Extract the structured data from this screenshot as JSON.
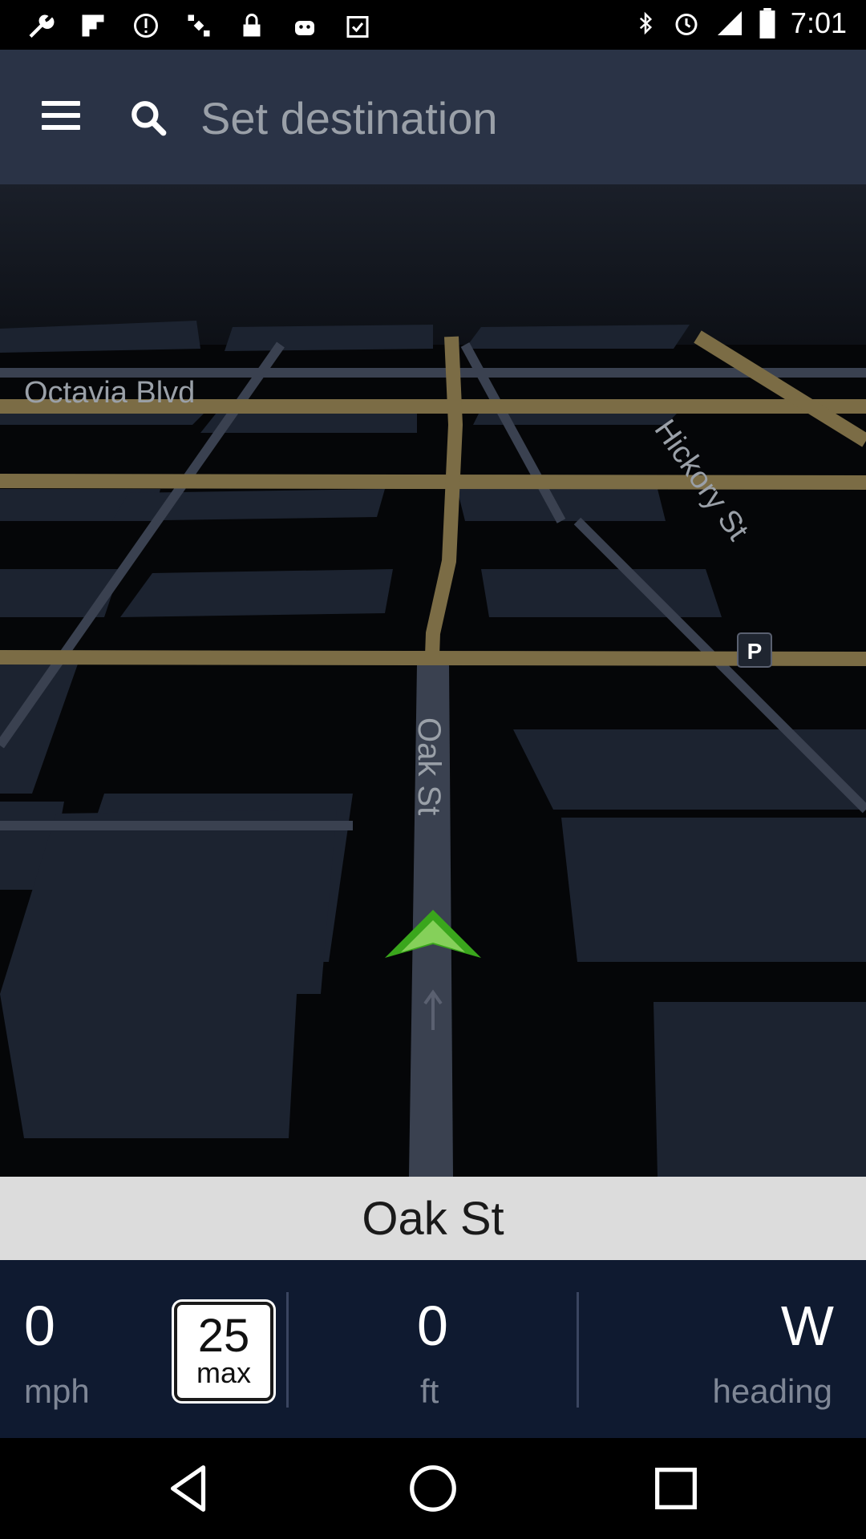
{
  "status_bar": {
    "time": "7:01",
    "left_icons": [
      "wrench-icon",
      "flipboard-icon",
      "alert-icon",
      "satellite-icon",
      "lock-icon",
      "android-icon",
      "clipboard-check-icon"
    ],
    "right_icons": [
      "bluetooth-icon",
      "alarm-icon",
      "signal-icon",
      "battery-icon"
    ]
  },
  "search": {
    "placeholder": "Set destination"
  },
  "map": {
    "street_labels": {
      "octavia": "Octavia  Blvd",
      "hickory": "Hickory St",
      "oak": "Oak St"
    },
    "parking_label": "P",
    "colors": {
      "road": "#7b6c45",
      "background": "#0a0a0a",
      "marker": "#3aa61c"
    }
  },
  "banner": {
    "street": "Oak St"
  },
  "info": {
    "speed_value": "0",
    "speed_unit": "mph",
    "speed_limit_value": "25",
    "speed_limit_label": "max",
    "distance_value": "0",
    "distance_unit": "ft",
    "heading_value": "W",
    "heading_label": "heading"
  },
  "nav_bar": {
    "icons": [
      "back-icon",
      "home-icon",
      "recents-icon"
    ]
  }
}
